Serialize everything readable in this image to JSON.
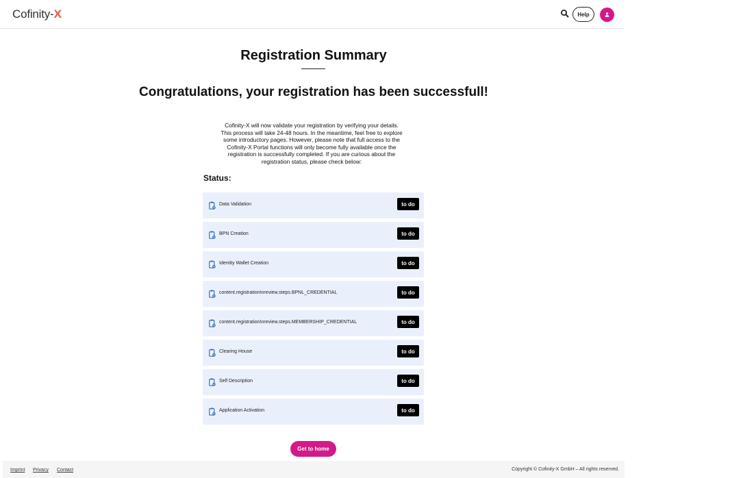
{
  "header": {
    "logo_text": "Cofinity-",
    "logo_accent": "X",
    "search_icon": "search-icon",
    "help_label": "Help",
    "avatar_icon": "user-icon"
  },
  "main": {
    "title": "Registration Summary",
    "congrats": "Congratulations, your registration has been successfull!",
    "intro_lines": [
      "Cofinity-X will now validate your registration by verifying your details.",
      "This process will take 24-48 hours. In the meantime, feel free to explore",
      "some introductory pages. However, please note that full access to the",
      "Cofinity-X Portal functions will only become fully available once the",
      "registration is successfully completed. If you are curious about the",
      "registration status, please check below:"
    ],
    "status_label": "Status:",
    "steps": [
      {
        "label": "Data Validation",
        "status": "to do"
      },
      {
        "label": "BPN Creation",
        "status": "to do"
      },
      {
        "label": "Identity Wallet Creation",
        "status": "to do"
      },
      {
        "label": "content.registrationInreview.steps.BPNL_CREDENTIAL",
        "status": "to do"
      },
      {
        "label": "content.registrationInreview.steps.MEMBERSHIP_CREDENTIAL",
        "status": "to do"
      },
      {
        "label": "Clearing House",
        "status": "to do"
      },
      {
        "label": "Self Description",
        "status": "to do"
      },
      {
        "label": "Application Activation",
        "status": "to do"
      }
    ],
    "home_button": "Get to home"
  },
  "footer": {
    "links": [
      "Imprint",
      "Privacy",
      "Contact"
    ],
    "copyright": "Copyright © Cofinity-X GmbH – All rights reserved."
  },
  "colors": {
    "accent": "#d31a8a",
    "logo_x": "#e8533f",
    "step_bg": "#eaf0fb",
    "step_icon": "#3d6fb5"
  }
}
